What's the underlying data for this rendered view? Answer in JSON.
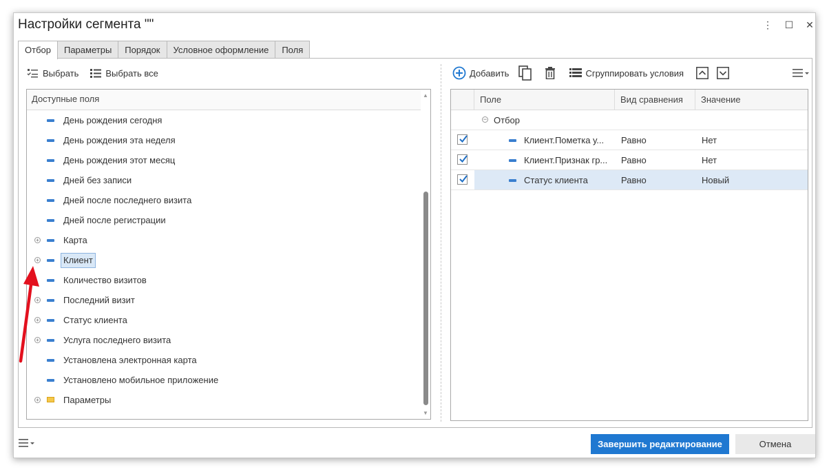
{
  "window": {
    "title": "Настройки сегмента \"\"",
    "controls": {
      "more": "⋮",
      "maximize": "☐",
      "close": "✕"
    }
  },
  "tabs": [
    {
      "label": "Отбор",
      "active": true
    },
    {
      "label": "Параметры",
      "active": false
    },
    {
      "label": "Порядок",
      "active": false
    },
    {
      "label": "Условное оформление",
      "active": false
    },
    {
      "label": "Поля",
      "active": false
    }
  ],
  "left_toolbar": {
    "select_label": "Выбрать",
    "select_all_label": "Выбрать все"
  },
  "tree": {
    "header": "Доступные поля",
    "items": [
      {
        "label": "День рождения сегодня",
        "expandable": false,
        "icon": "field-icon"
      },
      {
        "label": "День рождения эта неделя",
        "expandable": false,
        "icon": "field-icon"
      },
      {
        "label": "День рождения этот месяц",
        "expandable": false,
        "icon": "field-icon"
      },
      {
        "label": "Дней без записи",
        "expandable": false,
        "icon": "field-icon"
      },
      {
        "label": "Дней после последнего визита",
        "expandable": false,
        "icon": "field-icon"
      },
      {
        "label": "Дней после регистрации",
        "expandable": false,
        "icon": "field-icon"
      },
      {
        "label": "Карта",
        "expandable": true,
        "icon": "field-icon"
      },
      {
        "label": "Клиент",
        "expandable": true,
        "icon": "field-icon",
        "selected": true
      },
      {
        "label": "Количество визитов",
        "expandable": false,
        "icon": "field-icon"
      },
      {
        "label": "Последний визит",
        "expandable": true,
        "icon": "field-icon"
      },
      {
        "label": "Статус клиента",
        "expandable": true,
        "icon": "field-icon"
      },
      {
        "label": "Услуга последнего визита",
        "expandable": true,
        "icon": "field-icon"
      },
      {
        "label": "Установлена электронная карта",
        "expandable": false,
        "icon": "field-icon"
      },
      {
        "label": "Установлено мобильное приложение",
        "expandable": false,
        "icon": "field-icon"
      },
      {
        "label": "Параметры",
        "expandable": true,
        "icon": "folder-icon"
      }
    ]
  },
  "right_toolbar": {
    "add_label": "Добавить",
    "group_label": "Сгруппировать условия"
  },
  "grid": {
    "columns": [
      "Поле",
      "Вид сравнения",
      "Значение"
    ],
    "group_label": "Отбор",
    "rows": [
      {
        "checked": true,
        "field": "Клиент.Пометка у...",
        "comparison": "Равно",
        "value": "Нет",
        "selected": false
      },
      {
        "checked": true,
        "field": "Клиент.Признак гр...",
        "comparison": "Равно",
        "value": "Нет",
        "selected": false
      },
      {
        "checked": true,
        "field": "Статус клиента",
        "comparison": "Равно",
        "value": "Новый",
        "selected": true
      }
    ]
  },
  "footer": {
    "finish_label": "Завершить редактирование",
    "cancel_label": "Отмена"
  },
  "colors": {
    "primary": "#1f78d1",
    "selection": "#dde9f6",
    "annotation_arrow": "#e3101e"
  }
}
